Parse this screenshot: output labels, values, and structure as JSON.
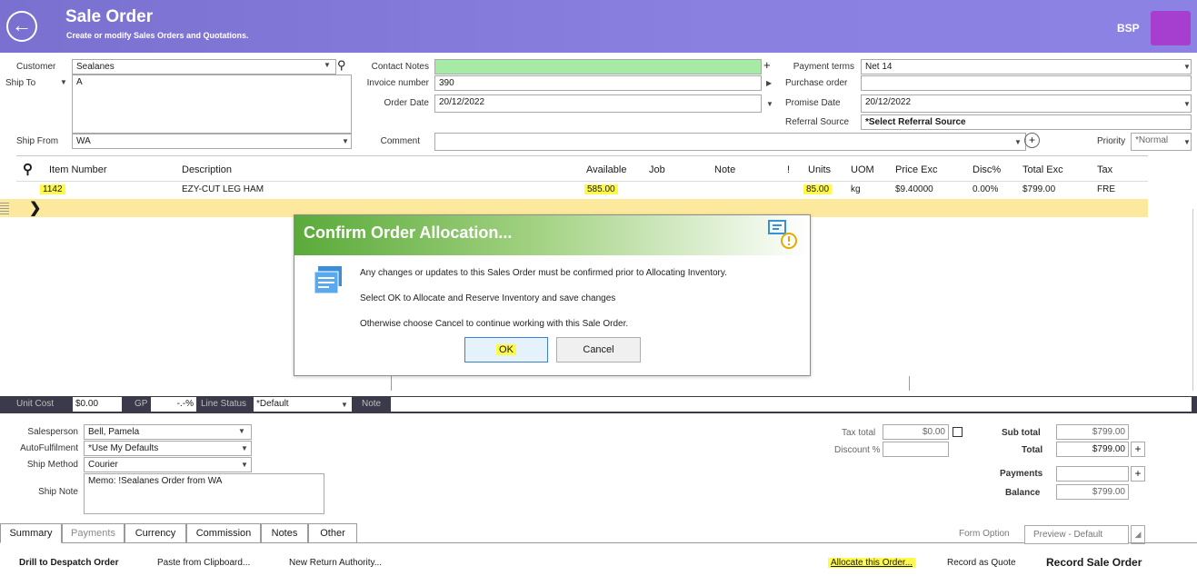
{
  "header": {
    "title": "Sale Order",
    "subtitle": "Create or modify Sales Orders and Quotations.",
    "brand": "BSP"
  },
  "form": {
    "customer_label": "Customer",
    "customer_value": "Sealanes",
    "ship_to_label": "Ship To",
    "ship_to_value": "A",
    "ship_from_label": "Ship From",
    "ship_from_value": "WA",
    "contact_notes_label": "Contact Notes",
    "invoice_number_label": "Invoice number",
    "invoice_number_value": "390",
    "order_date_label": "Order Date",
    "order_date_value": "20/12/2022",
    "comment_label": "Comment",
    "payment_terms_label": "Payment terms",
    "payment_terms_value": "Net 14",
    "purchase_order_label": "Purchase order",
    "promise_date_label": "Promise Date",
    "promise_date_value": "20/12/2022",
    "referral_source_label": "Referral Source",
    "referral_source_value": "*Select Referral Source",
    "priority_label": "Priority",
    "priority_value": "*Normal"
  },
  "grid": {
    "columns": [
      "Item Number",
      "Description",
      "Available",
      "Job",
      "Note",
      "!",
      "Units",
      "UOM",
      "Price Exc",
      "Disc%",
      "Total Exc",
      "Tax"
    ],
    "rows": [
      {
        "item_number": "1142",
        "description": "EZY-CUT LEG HAM",
        "available": "585.00",
        "units": "85.00",
        "uom": "kg",
        "price_exc": "$9.40000",
        "disc": "0.00%",
        "total_exc": "$799.00",
        "tax": "FRE"
      }
    ]
  },
  "dialog": {
    "title": "Confirm Order Allocation...",
    "line1": "Any changes or updates to this Sales Order must be confirmed prior to Allocating Inventory.",
    "line2": "Select OK to Allocate and Reserve Inventory and save changes",
    "line3": "Otherwise choose Cancel to continue working with this Sale Order.",
    "ok_label": "OK",
    "cancel_label": "Cancel"
  },
  "line_bar": {
    "unit_cost_label": "Unit Cost",
    "unit_cost_value": "$0.00",
    "gp_label": "GP",
    "gp_value": "-.-%",
    "line_status_label": "Line Status",
    "line_status_value": "*Default",
    "note_label": "Note"
  },
  "footer_form": {
    "salesperson_label": "Salesperson",
    "salesperson_value": "Bell, Pamela",
    "autofulfilment_label": "AutoFulfilment",
    "autofulfilment_value": "*Use My Defaults",
    "ship_method_label": "Ship Method",
    "ship_method_value": "Courier",
    "ship_note_label": "Ship Note",
    "ship_note_value": "Memo: !Sealanes Order from WA",
    "tax_total_label": "Tax total",
    "tax_total_value": "$0.00",
    "discount_label": "Discount %",
    "sub_total_label": "Sub total",
    "sub_total_value": "$799.00",
    "total_label": "Total",
    "total_value": "$799.00",
    "payments_label": "Payments",
    "balance_label": "Balance",
    "balance_value": "$799.00"
  },
  "tabs": [
    "Summary",
    "Payments",
    "Currency",
    "Commission",
    "Notes",
    "Other"
  ],
  "form_option": {
    "label": "Form Option",
    "value": "Preview - Default"
  },
  "actions": {
    "drill": "Drill to Despatch Order",
    "paste": "Paste from Clipboard...",
    "new_return": "New Return Authority...",
    "allocate": "Allocate this Order...",
    "record_quote": "Record as Quote",
    "record_sale": "Record Sale Order"
  },
  "colors": {
    "header": "#8a80e0",
    "highlight": "#fff94a",
    "selected_row": "#fde99d",
    "contact_notes_bg": "#a6eba5",
    "dialog_title": "#5aaa3a"
  }
}
